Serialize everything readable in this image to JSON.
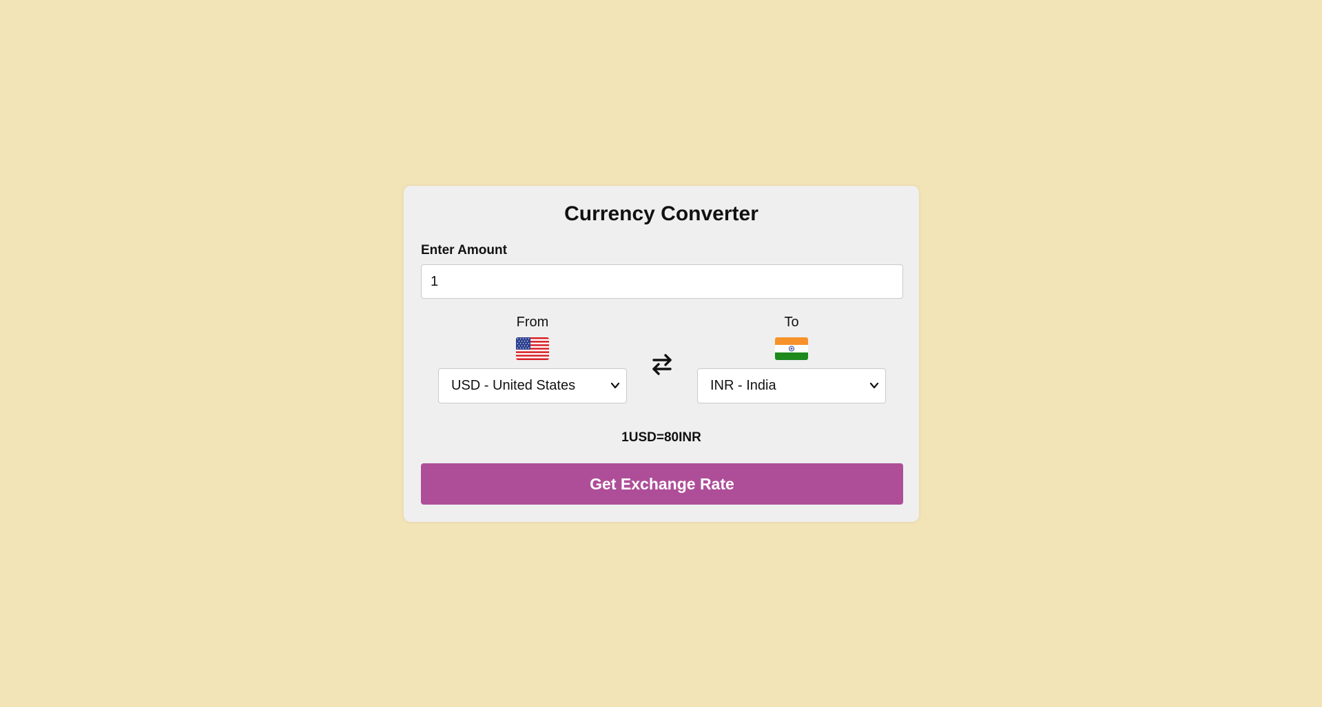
{
  "app": {
    "title": "Currency Converter"
  },
  "amount": {
    "label": "Enter Amount",
    "value": "1"
  },
  "from": {
    "label": "From",
    "flag_icon": "us-flag-icon",
    "selected": "USD - United States"
  },
  "to": {
    "label": "To",
    "flag_icon": "india-flag-icon",
    "selected": "INR - India"
  },
  "swap": {
    "icon": "swap-arrows-icon"
  },
  "result": {
    "text": "1USD=80INR"
  },
  "action": {
    "label": "Get Exchange Rate"
  },
  "colors": {
    "background": "#f3e4b8",
    "card": "#efefef",
    "button": "#ae4e98",
    "button_text": "#ffffff"
  }
}
